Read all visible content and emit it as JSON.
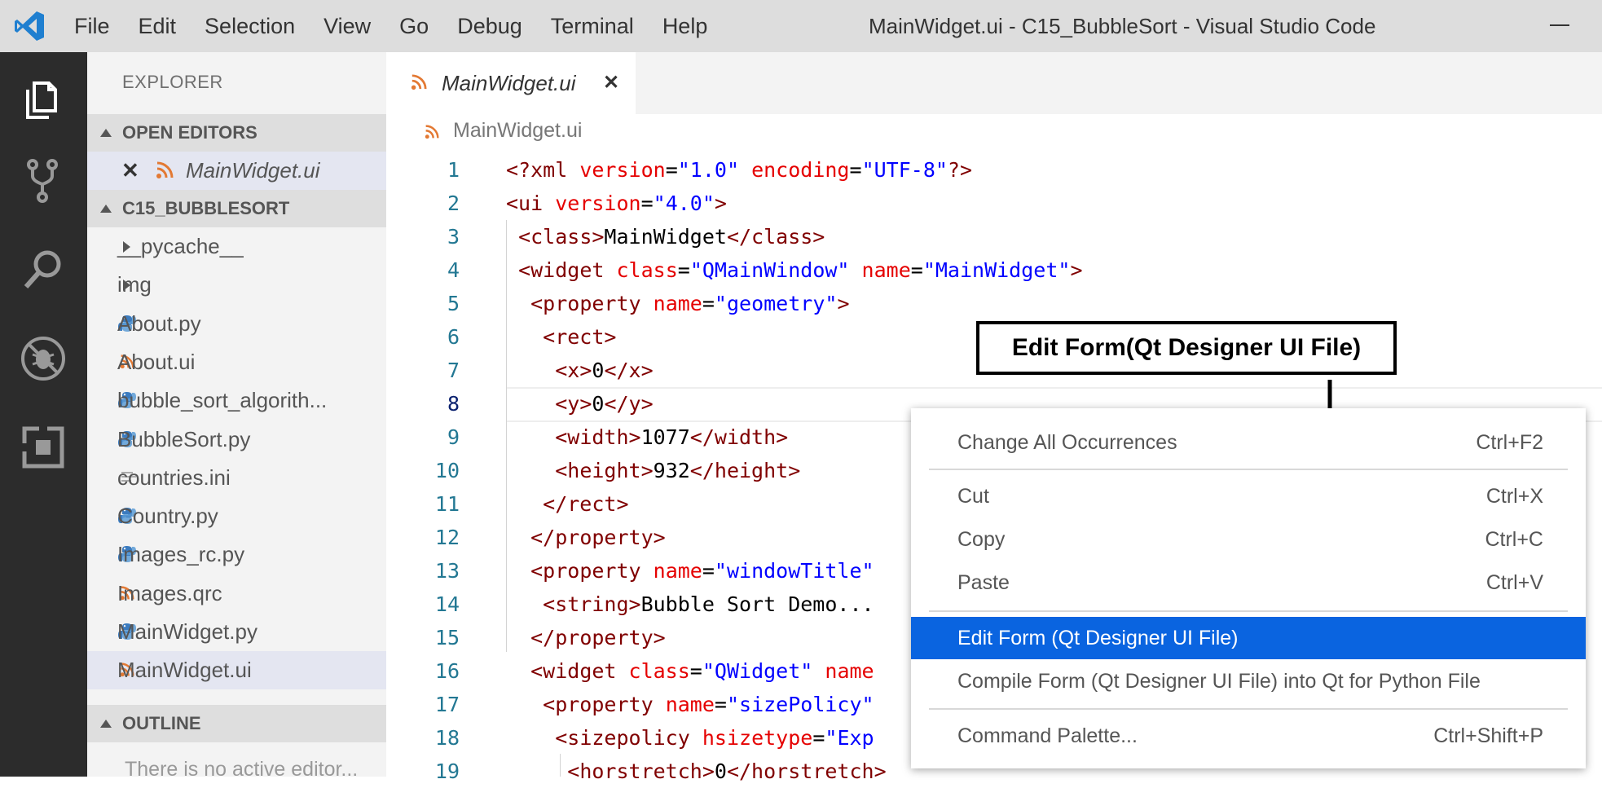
{
  "menu": [
    "File",
    "Edit",
    "Selection",
    "View",
    "Go",
    "Debug",
    "Terminal",
    "Help"
  ],
  "window_title": "MainWidget.ui - C15_BubbleSort - Visual Studio Code",
  "sidebar": {
    "title": "EXPLORER",
    "open_editors_label": "OPEN EDITORS",
    "open_editor_file": "MainWidget.ui",
    "project_label": "C15_BUBBLESORT",
    "outline_label": "OUTLINE",
    "outline_hint": "There is no active editor...",
    "files": [
      {
        "name": "__pycache__",
        "type": "folder"
      },
      {
        "name": "img",
        "type": "folder"
      },
      {
        "name": "About.py",
        "type": "python"
      },
      {
        "name": "About.ui",
        "type": "rss"
      },
      {
        "name": "bubble_sort_algorith...",
        "type": "python"
      },
      {
        "name": "BubbleSort.py",
        "type": "python"
      },
      {
        "name": "countries.ini",
        "type": "text"
      },
      {
        "name": "Country.py",
        "type": "python"
      },
      {
        "name": "Images_rc.py",
        "type": "python"
      },
      {
        "name": "Images.qrc",
        "type": "rss"
      },
      {
        "name": "MainWidget.py",
        "type": "python"
      },
      {
        "name": "MainWidget.ui",
        "type": "rss"
      }
    ]
  },
  "editor": {
    "tab_label": "MainWidget.ui",
    "breadcrumb": "MainWidget.ui",
    "current_line": "8",
    "lines": [
      {
        "n": "1"
      },
      {
        "n": "2"
      },
      {
        "n": "3"
      },
      {
        "n": "4"
      },
      {
        "n": "5"
      },
      {
        "n": "6"
      },
      {
        "n": "7"
      },
      {
        "n": "8"
      },
      {
        "n": "9"
      },
      {
        "n": "10"
      },
      {
        "n": "11"
      },
      {
        "n": "12"
      },
      {
        "n": "13"
      },
      {
        "n": "14"
      },
      {
        "n": "15"
      },
      {
        "n": "16"
      },
      {
        "n": "17"
      },
      {
        "n": "18"
      },
      {
        "n": "19"
      }
    ]
  },
  "context_menu": {
    "items": [
      {
        "label": "Change All Occurrences",
        "shortcut": "Ctrl+F2"
      },
      {
        "label": "Cut",
        "shortcut": "Ctrl+X"
      },
      {
        "label": "Copy",
        "shortcut": "Ctrl+C"
      },
      {
        "label": "Paste",
        "shortcut": "Ctrl+V"
      },
      {
        "label": "Edit Form (Qt Designer UI File)",
        "shortcut": ""
      },
      {
        "label": "Compile Form (Qt Designer UI File) into Qt for Python File",
        "shortcut": ""
      },
      {
        "label": "Command Palette...",
        "shortcut": "Ctrl+Shift+P"
      }
    ],
    "highlighted_index": 4
  },
  "annotation": {
    "text": "Edit Form(Qt Designer UI File)"
  },
  "colors": {
    "accent": "#0a64e0",
    "activity_bar": "#2c2c2c",
    "xml_tag": "#800000",
    "xml_attr": "#e50000",
    "xml_value": "#0000ff"
  }
}
